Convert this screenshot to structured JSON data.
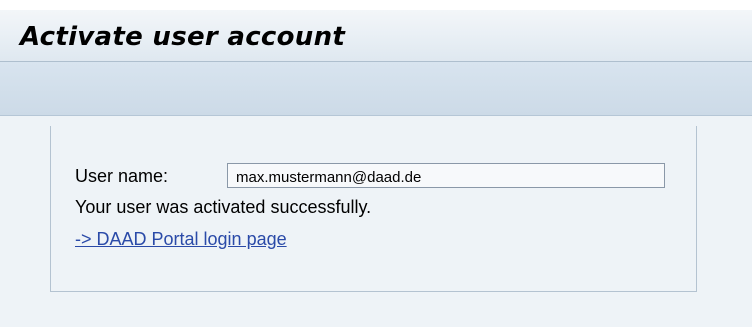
{
  "header": {
    "title": "Activate user account"
  },
  "form": {
    "username_label": "User name:",
    "username_value": "max.mustermann@daad.de"
  },
  "status": {
    "message": "Your user was activated successfully."
  },
  "links": {
    "portal_login": "-> DAAD Portal login page"
  },
  "colors": {
    "link": "#2a4aa8",
    "title_bar": "#e7eef4",
    "toolbar": "#ccdae7",
    "content_bg": "#eef3f7"
  }
}
